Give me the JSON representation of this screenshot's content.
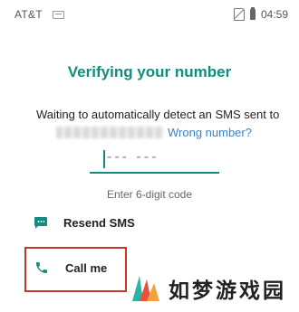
{
  "status_bar": {
    "carrier": "AT&T",
    "time": "04:59",
    "icons": [
      "screen-cast-icon",
      "no-sim-icon",
      "battery-icon"
    ]
  },
  "title": "Verifying your number",
  "description": {
    "line1": "Waiting to automatically detect an SMS sent to",
    "wrong_number_link": "Wrong number?"
  },
  "code_input": {
    "placeholder": "--- ---",
    "hint": "Enter 6-digit code"
  },
  "options": {
    "resend_sms": {
      "label": "Resend SMS",
      "icon": "sms-icon"
    },
    "call_me": {
      "label": "Call me",
      "icon": "phone-icon"
    }
  },
  "watermark": {
    "text": "如梦游戏园"
  },
  "colors": {
    "accent": "#128c7e",
    "link": "#3b82c4",
    "highlight": "#c0392b"
  }
}
